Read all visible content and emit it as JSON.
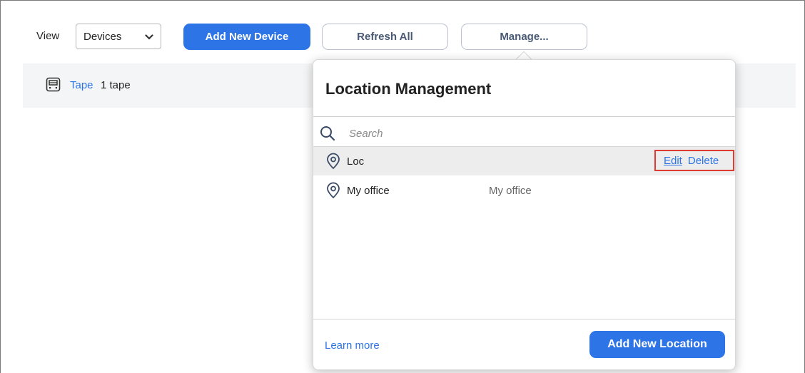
{
  "toolbar": {
    "view_label": "View",
    "view_select_value": "Devices",
    "add_device_label": "Add New Device",
    "refresh_label": "Refresh All",
    "manage_label": "Manage..."
  },
  "devices": {
    "type_link": "Tape",
    "count_text": "1 tape"
  },
  "popover": {
    "title": "Location Management",
    "search_placeholder": "Search",
    "locations": [
      {
        "name": "Loc",
        "description": "",
        "edit_label": "Edit",
        "delete_label": "Delete"
      },
      {
        "name": "My office",
        "description": "My office"
      }
    ],
    "learn_more_label": "Learn more",
    "add_location_label": "Add New Location"
  },
  "colors": {
    "accent": "#2d74e6",
    "highlight_border": "#e03b32",
    "selected_row": "#ededed"
  },
  "icons": {
    "view_select": "chevron-down-icon",
    "device": "tape-drive-icon",
    "search": "search-icon",
    "location": "location-pin-icon"
  }
}
